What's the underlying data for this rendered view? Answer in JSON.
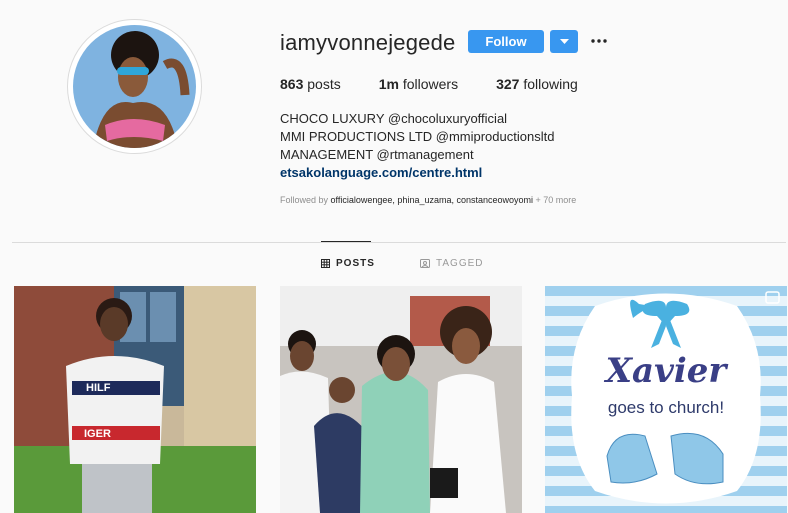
{
  "profile": {
    "username": "iamyvonnejegede",
    "follow_label": "Follow",
    "stats": [
      {
        "count": "863",
        "label": "posts"
      },
      {
        "count": "1m",
        "label": "followers"
      },
      {
        "count": "327",
        "label": "following"
      }
    ],
    "bio": [
      "CHOCO LUXURY @chocoluxuryofficial",
      "MMI PRODUCTIONS LTD @mmiproductionsltd",
      "MANAGEMENT @rtmanagement"
    ],
    "link": "etsakolanguage.com/centre.html",
    "followed_by_prefix": "Followed by",
    "followed_by_users": "officialowengee, phina_uzama, constanceowoyomi",
    "followed_by_more": "+ 70 more"
  },
  "tabs": [
    {
      "label": "POSTS",
      "active": true,
      "icon": "grid-icon"
    },
    {
      "label": "TAGGED",
      "active": false,
      "icon": "tag-icon"
    }
  ],
  "posts": [
    {
      "icon": "photo-boy-in-sweater"
    },
    {
      "icon": "photo-family-group"
    },
    {
      "icon": "photo-baby-shower-card",
      "card_line1": "Xavier",
      "card_line2": "goes to church!"
    }
  ],
  "colors": {
    "accent": "#3897f0",
    "card_text": "#3a3f86",
    "card_subtext": "#2e3a6b"
  }
}
